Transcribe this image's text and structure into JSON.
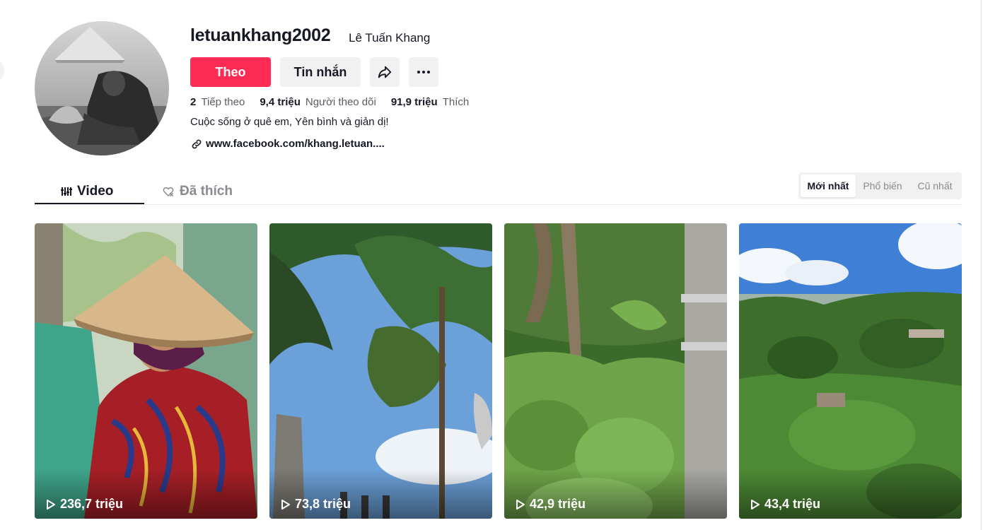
{
  "profile": {
    "username": "letuankhang2002",
    "nickname": "Lê Tuấn Khang",
    "follow_label": "Theo",
    "message_label": "Tin nhắn",
    "stats": {
      "following_count": "2",
      "following_label": "Tiếp theo",
      "followers_count": "9,4 triệu",
      "followers_label": "Người theo dõi",
      "likes_count": "91,9 triệu",
      "likes_label": "Thích"
    },
    "bio": "Cuộc sống ở quê em, Yên bình và giản dị!",
    "link": "www.facebook.com/khang.letuan...."
  },
  "tabs": {
    "video_label": "Video",
    "liked_label": "Đã thích"
  },
  "sort": {
    "latest": "Mới nhất",
    "popular": "Phổ biến",
    "oldest": "Cũ nhất",
    "selected": "Mới nhất"
  },
  "videos": [
    {
      "views": "236,7 triệu"
    },
    {
      "views": "73,8 triệu"
    },
    {
      "views": "42,9 triệu"
    },
    {
      "views": "43,4 triệu"
    }
  ],
  "colors": {
    "accent": "#fe2c55",
    "text_primary": "#161823",
    "text_secondary": "#5b5c63",
    "button_gray": "#f1f1f2"
  },
  "icons": [
    "share-arrow-icon",
    "more-dots-icon",
    "link-icon",
    "video-grid-icon",
    "liked-heart-icon",
    "play-icon"
  ]
}
